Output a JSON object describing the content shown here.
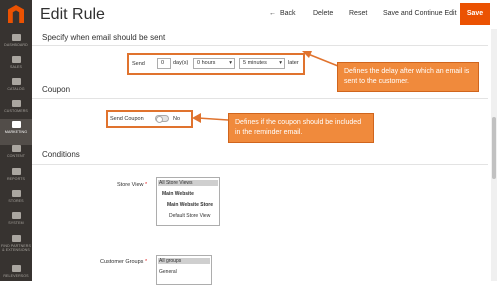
{
  "sidebar": {
    "items": [
      {
        "label": "DASHBOARD",
        "active": false
      },
      {
        "label": "SALES",
        "active": false
      },
      {
        "label": "CATALOG",
        "active": false
      },
      {
        "label": "CUSTOMERS",
        "active": false
      },
      {
        "label": "MARKETING",
        "active": true
      },
      {
        "label": "CONTENT",
        "active": false
      },
      {
        "label": "REPORTS",
        "active": false
      },
      {
        "label": "STORES",
        "active": false
      },
      {
        "label": "SYSTEM",
        "active": false
      },
      {
        "label": "FIND PARTNERS & EXTENSIONS",
        "active": false
      },
      {
        "label": "RELEVERSOS",
        "active": false
      }
    ]
  },
  "header": {
    "title": "Edit Rule",
    "back_label": "Back",
    "delete_label": "Delete",
    "reset_label": "Reset",
    "save_continue_label": "Save and Continue Edit",
    "save_label": "Save"
  },
  "send_section": {
    "heading": "Specify when email should be sent",
    "send_label": "Send",
    "days_value": "0",
    "days_unit": "day(s)",
    "hours_value": "0 hours",
    "minutes_value": "5 minutes",
    "later_label": "later",
    "callout": "Defines the delay after which an email is sent to the customer."
  },
  "coupon_section": {
    "heading": "Coupon",
    "send_coupon_label": "Send Coupon",
    "toggle_value": "No",
    "callout": "Defines if the coupon should be included in the reminder email."
  },
  "conditions_section": {
    "heading": "Conditions",
    "store_view_label": "Store View",
    "store_view_options": [
      "All Store Views",
      "Main Website",
      "Main Website Store",
      "Default Store View"
    ],
    "customer_groups_label": "Customer Groups",
    "customer_groups_options": [
      "All groups",
      "General"
    ]
  },
  "colors": {
    "accent": "#eb5202",
    "callout": "#f08a3c",
    "sidebar": "#373330"
  }
}
